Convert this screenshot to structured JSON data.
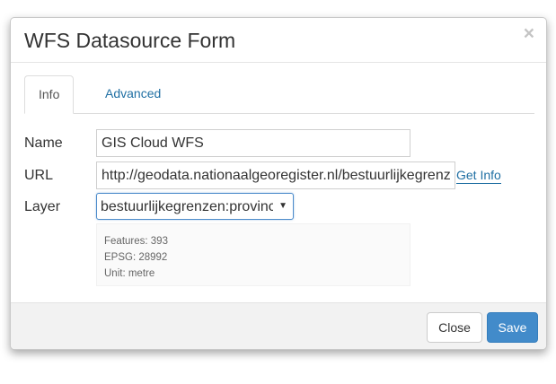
{
  "modal": {
    "title": "WFS Datasource Form",
    "close_glyph": "×"
  },
  "tabs": [
    {
      "label": "Info",
      "active": true
    },
    {
      "label": "Advanced",
      "active": false
    }
  ],
  "form": {
    "name_label": "Name",
    "name_value": "GIS Cloud WFS",
    "url_label": "URL",
    "url_value": "http://geodata.nationaalgeoregister.nl/bestuurlijkegrenzen/wfs",
    "get_info_label": "Get Info",
    "layer_label": "Layer",
    "layer_value": "bestuurlijkegrenzen:provincies",
    "layer_caret": "▼"
  },
  "info": {
    "features": "Features: 393",
    "epsg": "EPSG: 28992",
    "unit": "Unit: metre"
  },
  "footer": {
    "close_label": "Close",
    "save_label": "Save"
  },
  "colors": {
    "primary": "#428bca",
    "link": "#1f6fa3",
    "footer_bg": "#f2f2f2",
    "focus_border": "#4d8ccb"
  },
  "icons": {
    "close": "close-icon",
    "dropdown": "caret-down-icon"
  }
}
